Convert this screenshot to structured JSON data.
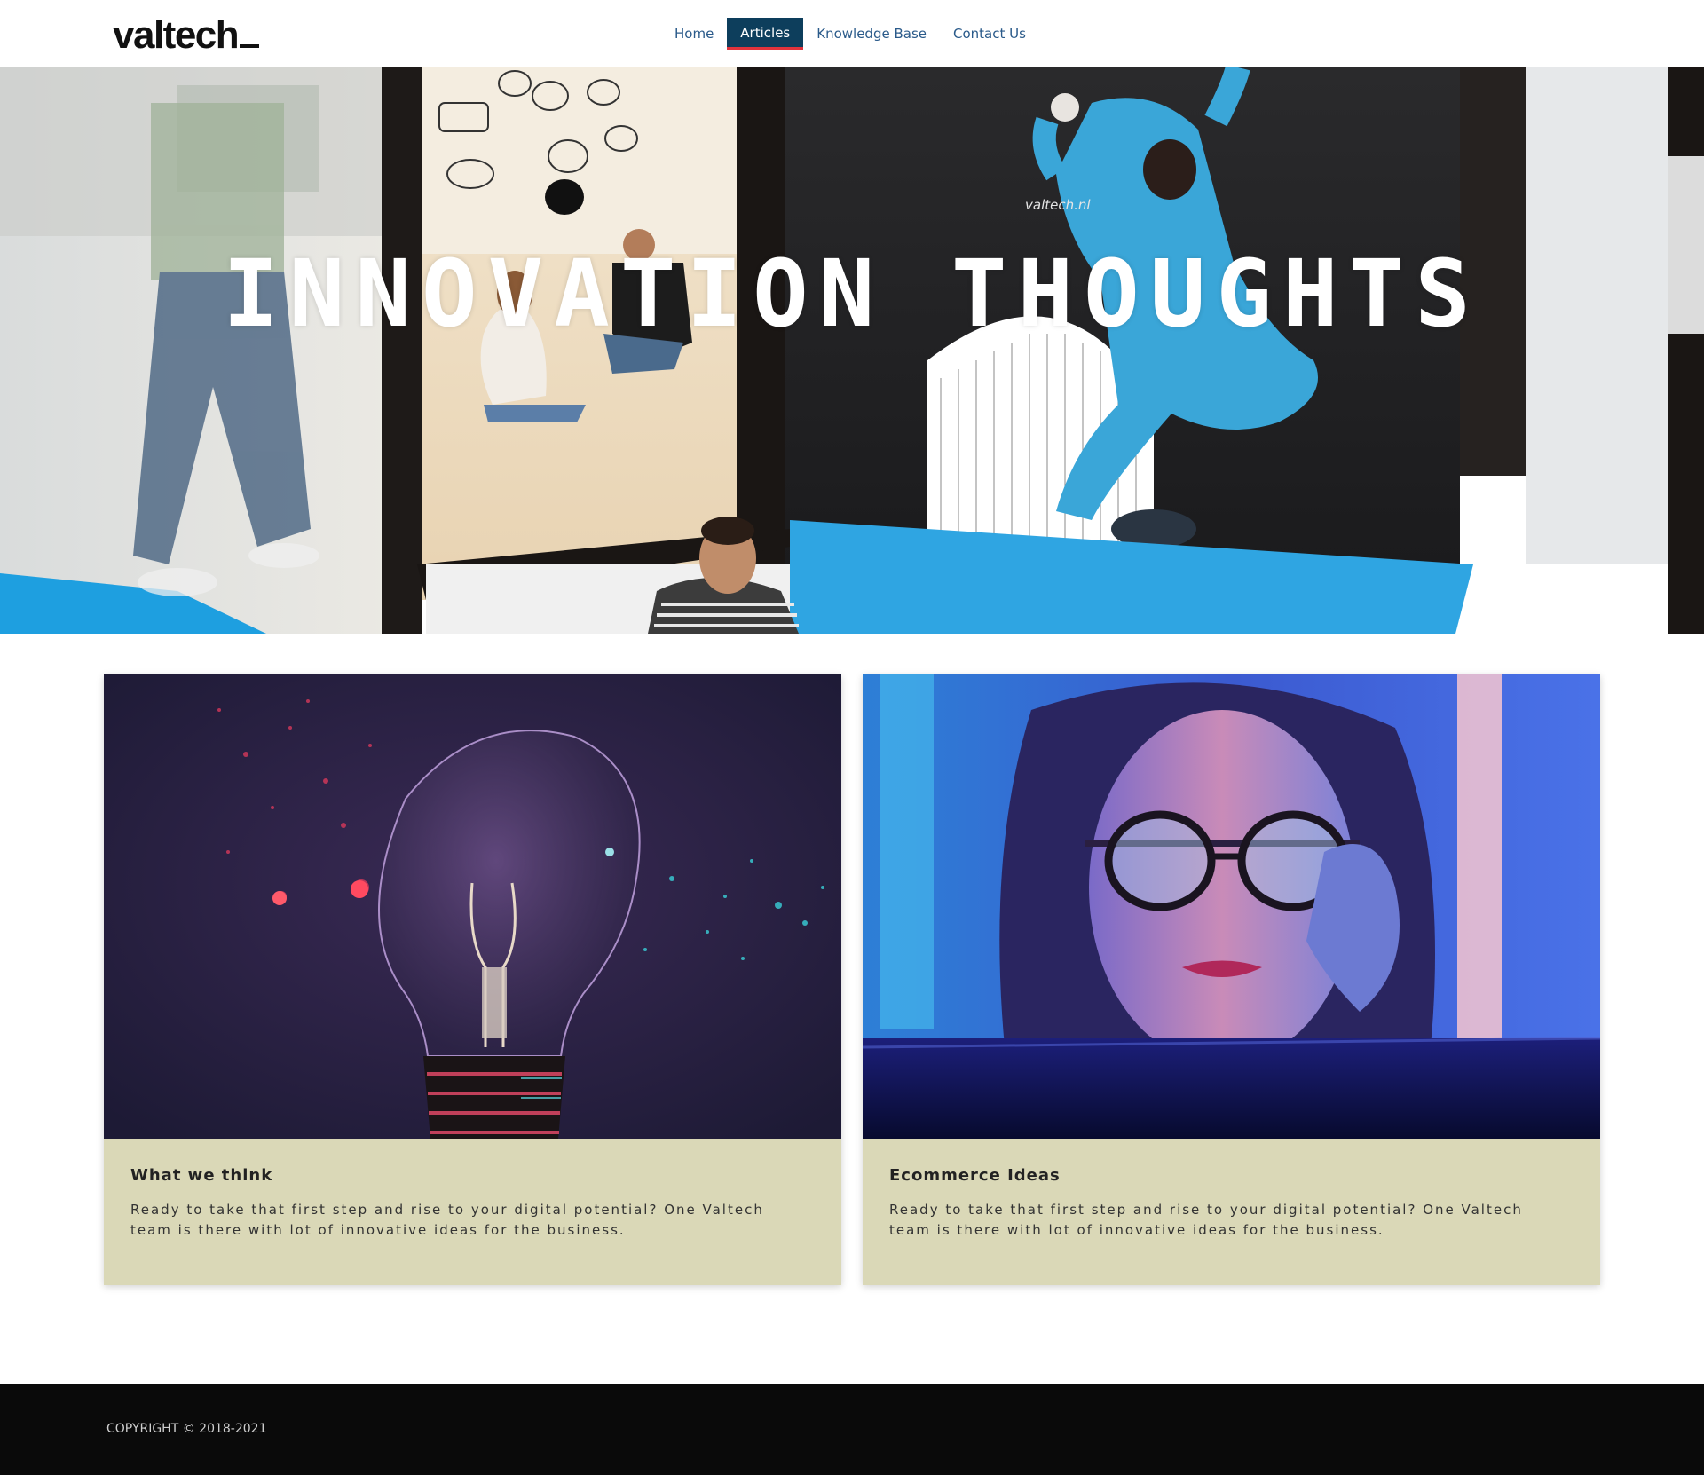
{
  "header": {
    "logo": "valtech",
    "nav": [
      {
        "label": "Home",
        "active": false
      },
      {
        "label": "Articles",
        "active": true
      },
      {
        "label": "Knowledge Base",
        "active": false
      },
      {
        "label": "Contact Us",
        "active": false
      }
    ]
  },
  "hero": {
    "title": "INNOVATION THOUGHTS",
    "poster_text": "valtech.nl"
  },
  "cards": [
    {
      "title": "What we think",
      "text": "Ready to take that first step and rise to your digital potential? One Valtech team is there with lot of innovative ideas for the business.",
      "image": "exploding-lightbulb-photo"
    },
    {
      "title": "Ecommerce Ideas",
      "text": "Ready to take that first step and rise to your digital potential? One Valtech team is there with lot of innovative ideas for the business.",
      "image": "woman-neon-glasses-photo"
    }
  ],
  "footer": {
    "copyright": "COPYRIGHT © 2018-2021"
  },
  "colors": {
    "nav_active_bg": "#0d3e5c",
    "nav_active_underline": "#e0333c",
    "nav_link": "#2a5a8a",
    "card_bg": "#dad8b7",
    "footer_bg": "#0a0a0a"
  }
}
